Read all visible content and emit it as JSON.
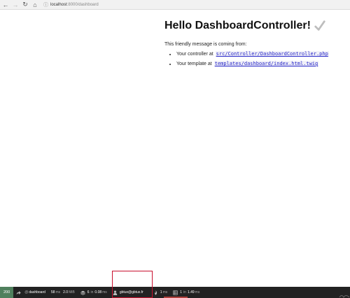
{
  "browser": {
    "url_host": "localhost",
    "url_path": ":8000/dashboard"
  },
  "page": {
    "title": "Hello DashboardController!",
    "intro": "This friendly message is coming from:",
    "items": [
      {
        "label": "Your controller at",
        "path": "src/Controller/DashboardController.php"
      },
      {
        "label": "Your template at",
        "path": "templates/dashboard/index.html.twig"
      }
    ]
  },
  "toolbar": {
    "status": "200",
    "route_prefix": "@",
    "route": "dashboard",
    "time_value": "58",
    "time_unit": "ms",
    "memory_value": "2.0",
    "memory_unit": "MiB",
    "cache_value": "6",
    "cache_sep": "in",
    "cache_time": "0.08",
    "cache_unit": "ms",
    "user": "gbtux@gbtux.fr",
    "twig_value": "1",
    "twig_unit": "ms",
    "db_value": "1",
    "db_sep": "in",
    "db_time": "1.49",
    "db_unit": "ms"
  }
}
